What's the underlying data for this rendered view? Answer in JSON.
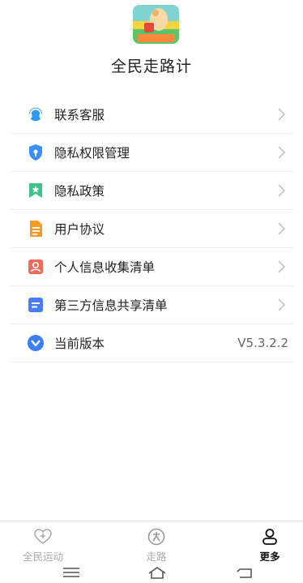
{
  "app": {
    "name": "全民走路计",
    "logo_caption": "全民走路计"
  },
  "menu": {
    "items": [
      {
        "label": "联系客服",
        "icon": "headset-icon",
        "color": "#2f9bf0"
      },
      {
        "label": "隐私权限管理",
        "icon": "shield-icon",
        "color": "#3b8ef5"
      },
      {
        "label": "隐私政策",
        "icon": "bookmark-star-icon",
        "color": "#3fc38a"
      },
      {
        "label": "用户协议",
        "icon": "document-icon",
        "color": "#f59a23"
      },
      {
        "label": "个人信息收集清单",
        "icon": "person-card-icon",
        "color": "#f06a5a"
      },
      {
        "label": "第三方信息共享清单",
        "icon": "list-card-icon",
        "color": "#4a7cf6"
      },
      {
        "label": "当前版本",
        "icon": "version-check-icon",
        "color": "#3b7ef6",
        "value": "V5.3.2.2"
      }
    ]
  },
  "tabbar": {
    "tabs": [
      {
        "label": "全民运动",
        "icon": "heart-plus-icon",
        "active": false
      },
      {
        "label": "走路",
        "icon": "walk-icon",
        "active": false
      },
      {
        "label": "更多",
        "icon": "person-icon",
        "active": true
      }
    ]
  },
  "system_nav": {
    "buttons": [
      "menu-icon",
      "home-icon",
      "back-icon"
    ]
  }
}
